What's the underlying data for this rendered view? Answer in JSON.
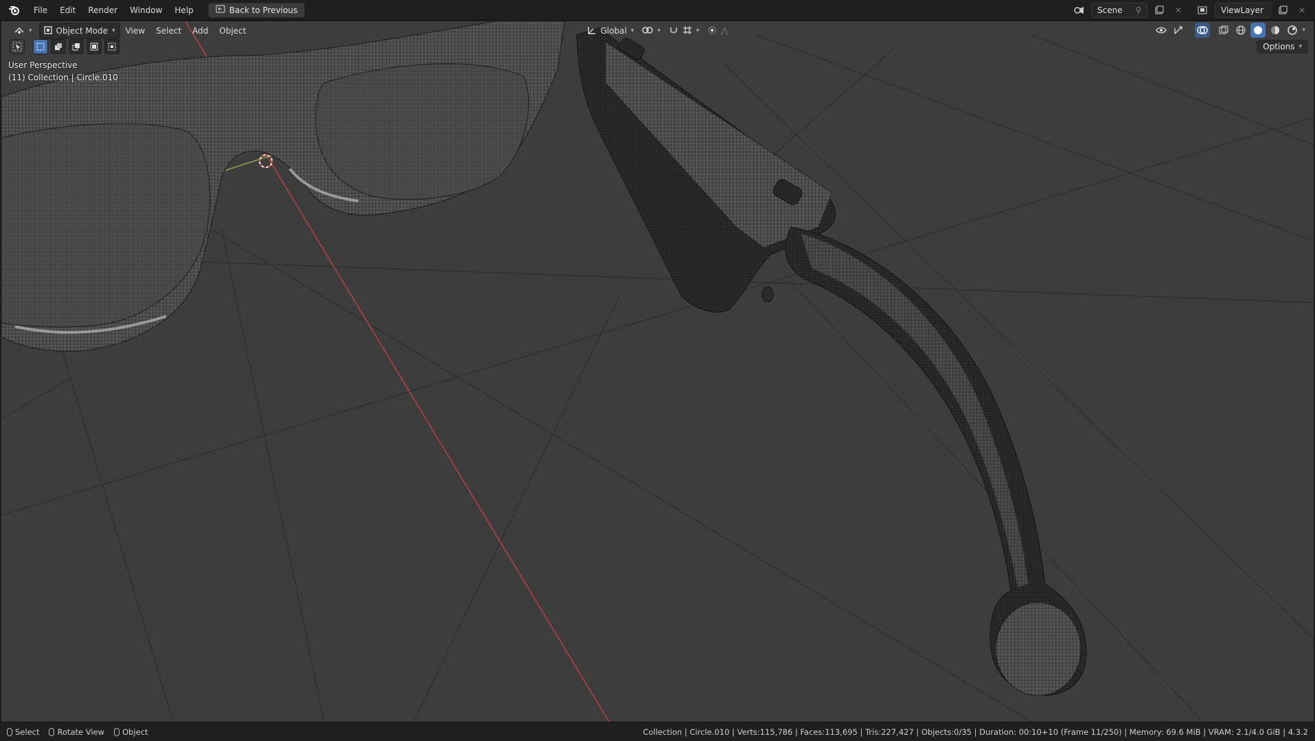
{
  "topbar": {
    "menus": [
      "File",
      "Edit",
      "Render",
      "Window",
      "Help"
    ],
    "back_label": "Back to Previous",
    "scene_label": "Scene",
    "viewlayer_label": "ViewLayer"
  },
  "viewport_header": {
    "mode_label": "Object Mode",
    "menus": [
      "View",
      "Select",
      "Add",
      "Object"
    ],
    "orientation_label": "Global",
    "options_label": "Options"
  },
  "overlay": {
    "perspective": "User Perspective",
    "collection": "(11) Collection | Circle.010"
  },
  "statusbar": {
    "hint_select": "Select",
    "hint_rotate": "Rotate View",
    "hint_object": "Object",
    "stats": "Collection | Circle.010 | Verts:115,786 | Faces:113,695 | Tris:227,427 | Objects:0/35 | Duration: 00:10+10 (Frame 11/250) | Memory: 69.6 MiB | VRAM: 2.1/4.0 GiB | 4.3.2"
  },
  "colors": {
    "x_axis": "#b5404a",
    "y_axis": "#7fa34a",
    "viewport_bg": "#3d3d3d",
    "accent": "#4772b3"
  },
  "icons": [
    "blender-logo-icon",
    "back-icon",
    "scene-icon",
    "viewlayer-icon",
    "editor-type-icon",
    "object-mode-icon",
    "orientation-icon",
    "pivot-icon",
    "snap-icon",
    "proportional-icon",
    "visibility-icon",
    "gizmo-icon",
    "overlay-icon",
    "xray-icon",
    "shading-wireframe-icon",
    "shading-solid-icon",
    "shading-material-icon",
    "shading-rendered-icon",
    "mouse-icon",
    "3d-cursor-icon"
  ]
}
